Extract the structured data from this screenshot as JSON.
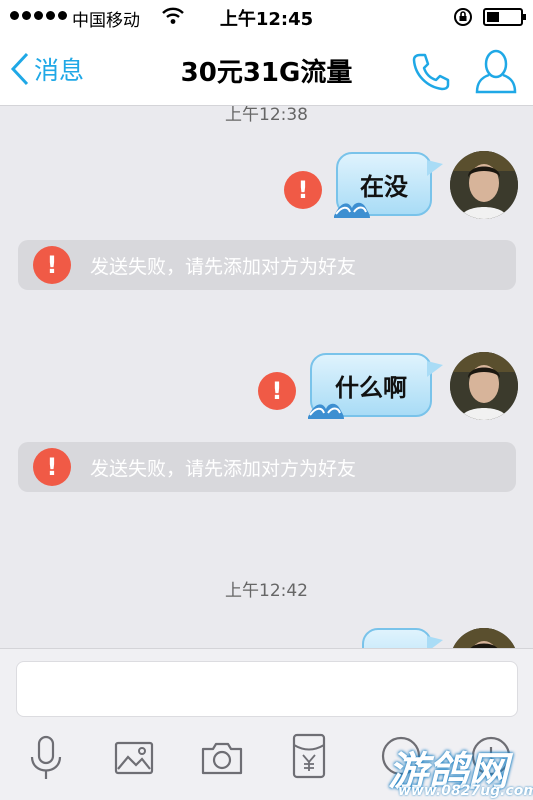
{
  "status_bar": {
    "carrier": "中国移动",
    "time": "上午12:45"
  },
  "nav": {
    "back_label": "消息",
    "title": "30元31G流量"
  },
  "chat": {
    "timestamp_1": "上午12:38",
    "timestamp_2": "上午12:42",
    "messages": [
      {
        "text": "在没",
        "status": "failed"
      },
      {
        "text": "什么啊",
        "status": "failed"
      },
      {
        "text": "",
        "status": "sending"
      }
    ],
    "notices": [
      {
        "error_mark": "!",
        "text": "发送失败，请先添加对方为好友"
      },
      {
        "error_mark": "!",
        "text": "发送失败，请先添加对方为好友"
      }
    ],
    "error_mark": "!"
  },
  "input": {
    "value": "",
    "placeholder": ""
  },
  "toolbar": [
    "mic-icon",
    "image-icon",
    "camera-icon",
    "red-packet-icon",
    "emoji-icon",
    "plus-icon"
  ],
  "watermark": {
    "logo_text": "游鸽网",
    "url": "www.0827ug.com"
  },
  "colors": {
    "accent": "#1fa8e6",
    "error": "#f05a46",
    "bubble": "#a9dcf6",
    "background": "#eaeaee"
  }
}
